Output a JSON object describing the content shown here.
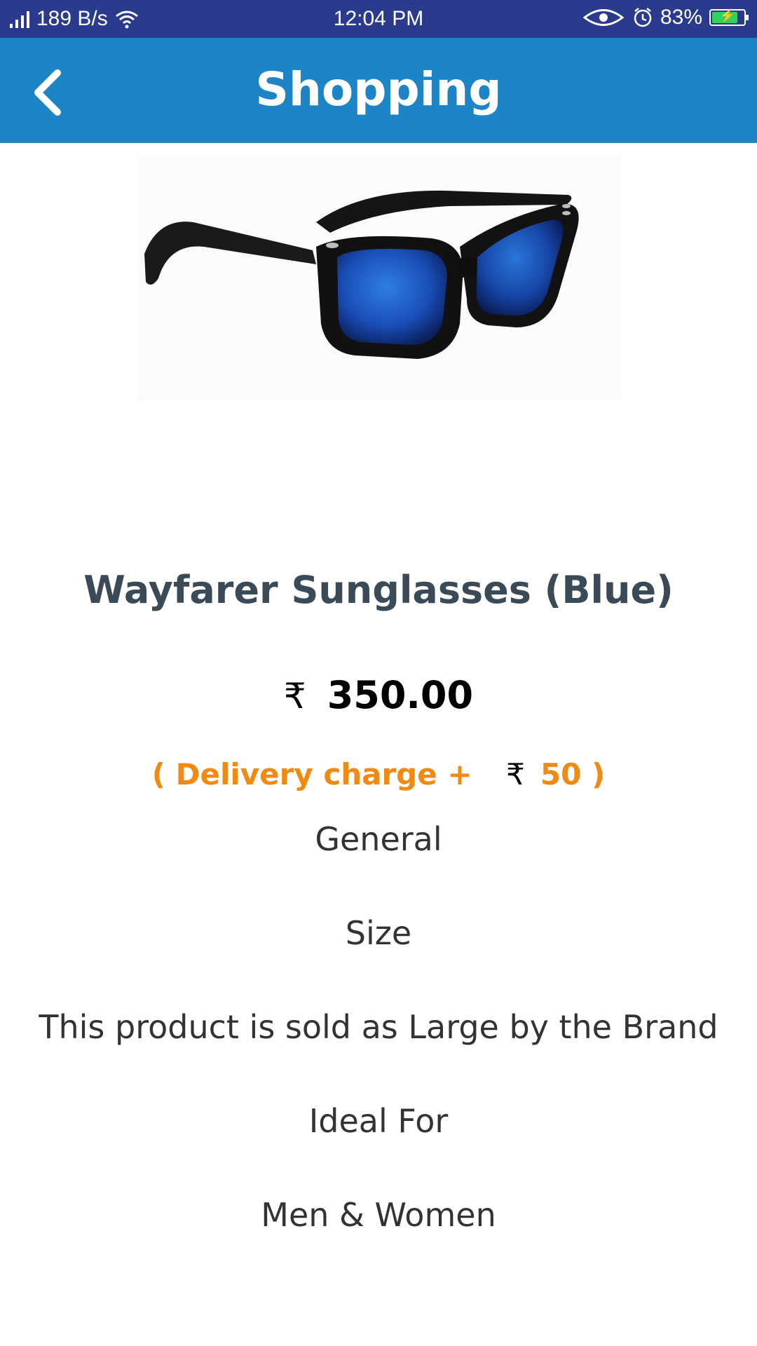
{
  "status_bar": {
    "network_speed": "189 B/s",
    "time": "12:04 PM",
    "battery_percent": "83%",
    "battery_level": 0.83,
    "battery_color": "#34d15c",
    "background_color": "#2a3a8c"
  },
  "app_bar": {
    "title": "Shopping",
    "back_icon": "chevron-left-icon",
    "background_color": "#1d85c6"
  },
  "product": {
    "image_icon": "sunglasses-image",
    "title": "Wayfarer Sunglasses  (Blue)",
    "currency_symbol": "₹",
    "price": "350.00",
    "delivery_prefix": "( Delivery charge + ",
    "delivery_currency": "₹",
    "delivery_amount": "50",
    "delivery_suffix": " )",
    "delivery_color": "#f08a12"
  },
  "specs": {
    "category": "General",
    "size_label": "Size",
    "size_value": "This product is sold as Large by the Brand",
    "ideal_label": "Ideal For",
    "ideal_value": "Men & Women"
  }
}
